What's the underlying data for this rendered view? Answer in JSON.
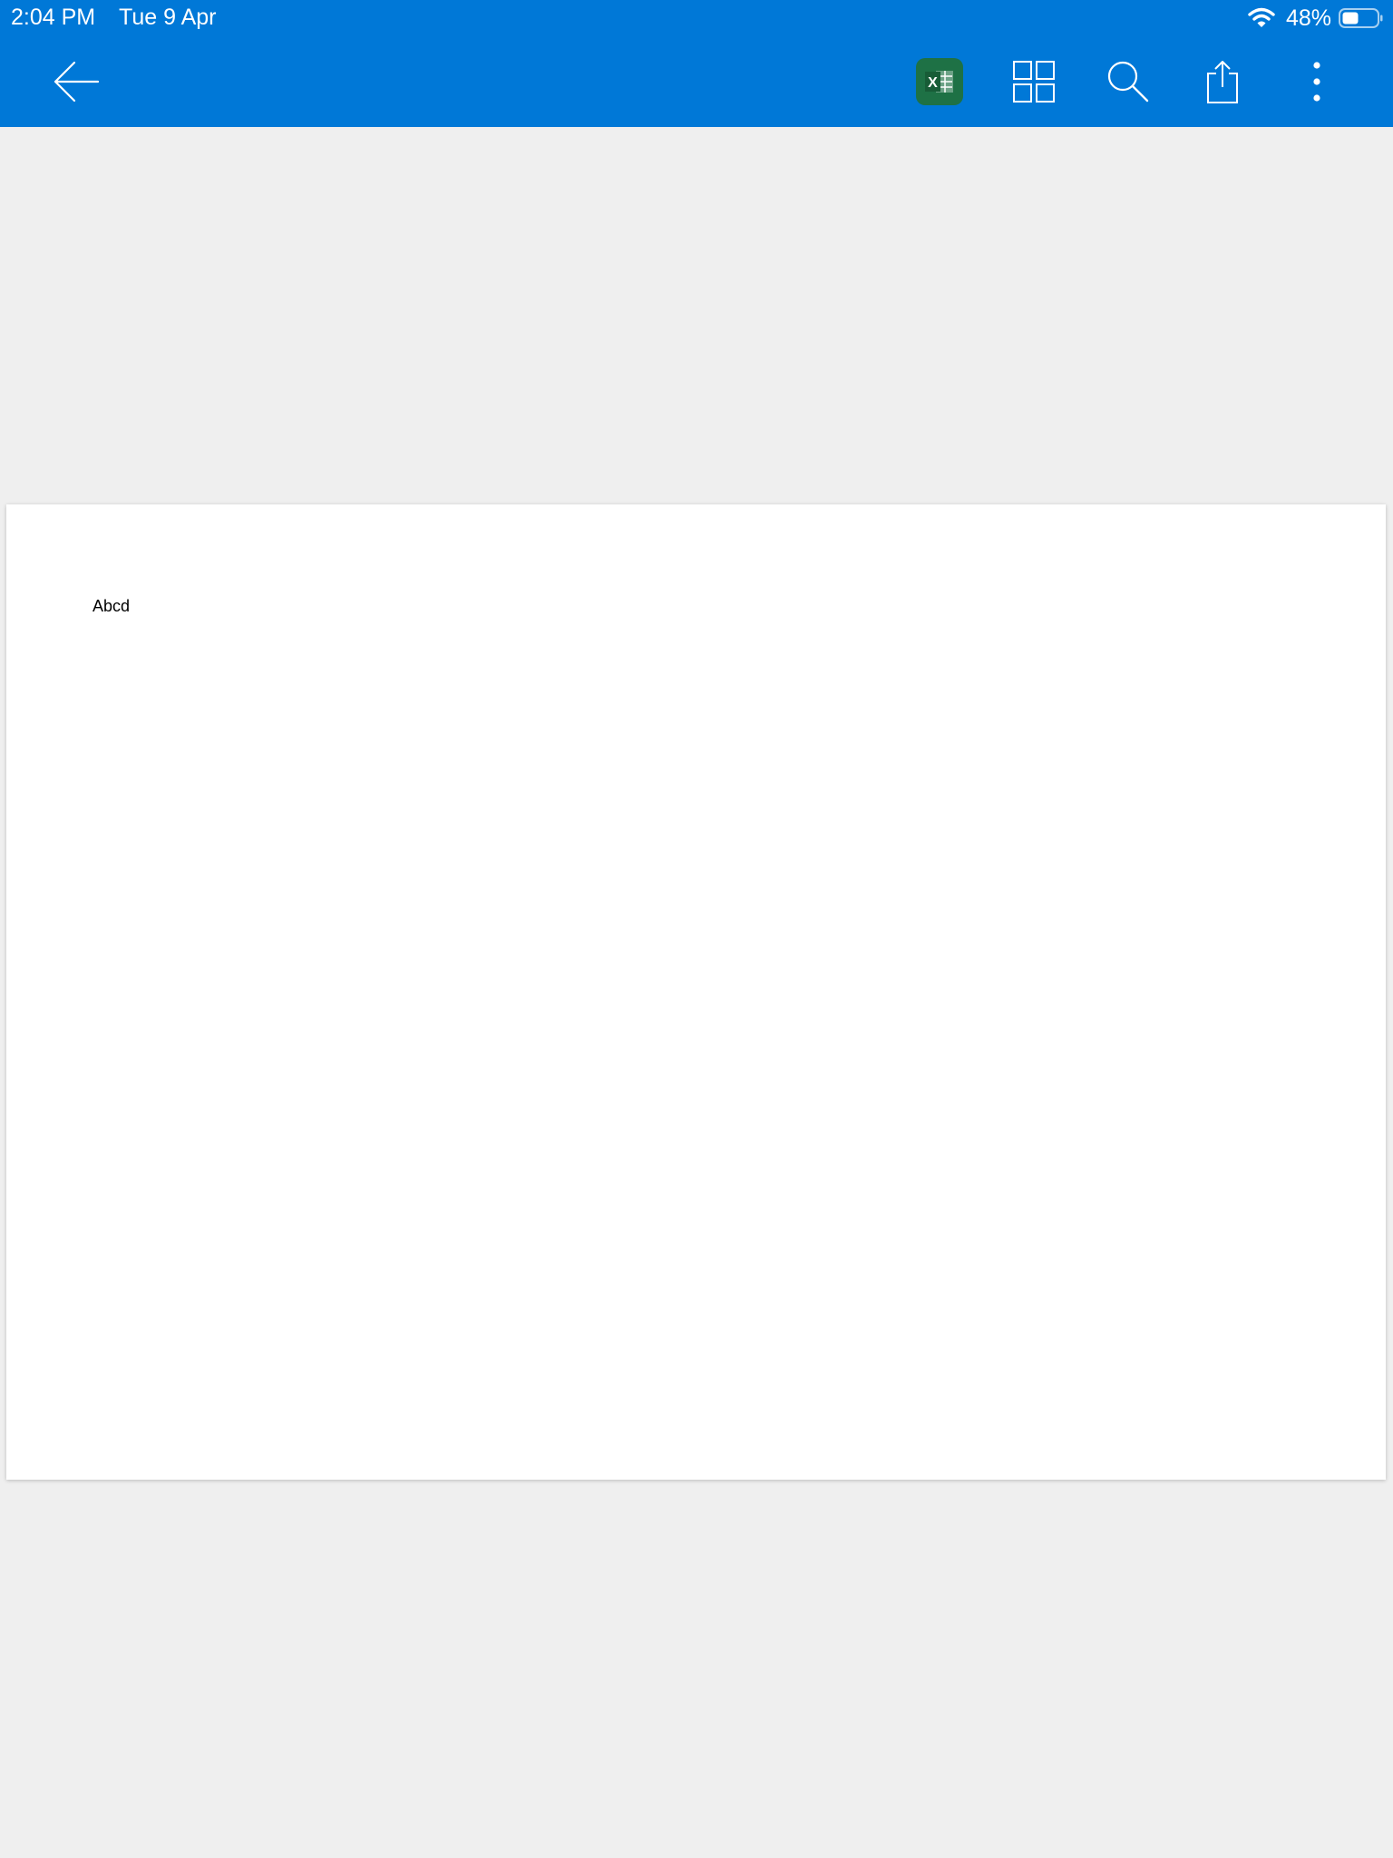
{
  "status_bar": {
    "time": "2:04 PM",
    "date": "Tue 9 Apr",
    "battery_percent": "48%",
    "battery_level": 0.48,
    "wifi_icon": "wifi-icon",
    "battery_icon": "battery-icon"
  },
  "toolbar": {
    "background": "#0078d7",
    "back_icon": "back-arrow-icon",
    "excel_icon": "excel-icon",
    "excel_glyph": "X",
    "excel_color": "#1e7145",
    "grid_icon": "grid-view-icon",
    "search_icon": "search-icon",
    "share_icon": "share-icon",
    "more_icon": "more-options-icon"
  },
  "document": {
    "text": "Abcd"
  }
}
